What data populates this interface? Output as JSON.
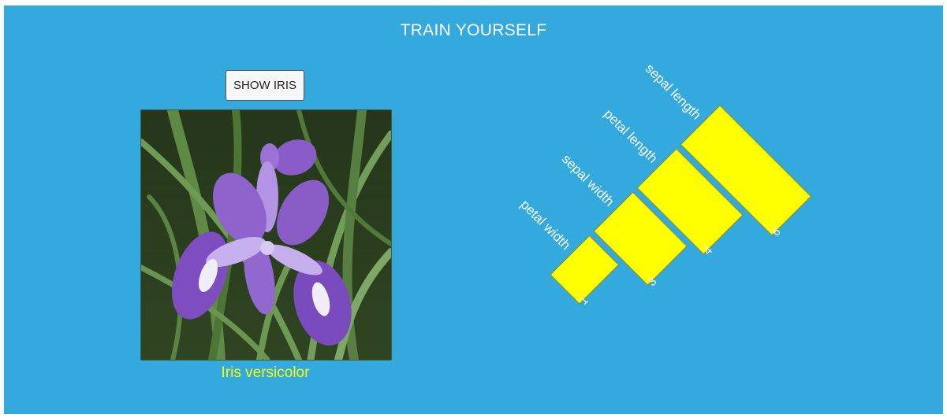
{
  "header": {
    "title": "TRAIN YOURSELF"
  },
  "controls": {
    "show_button_label": "SHOW IRIS"
  },
  "specimen": {
    "species": "Iris versicolor"
  },
  "glyph": {
    "bar_color": "#ffff00",
    "items": [
      {
        "feature": "petal width",
        "value": 1
      },
      {
        "feature": "sepal width",
        "value": 3
      },
      {
        "feature": "petal length",
        "value": 4
      },
      {
        "feature": "sepal length",
        "value": 6
      }
    ]
  }
}
